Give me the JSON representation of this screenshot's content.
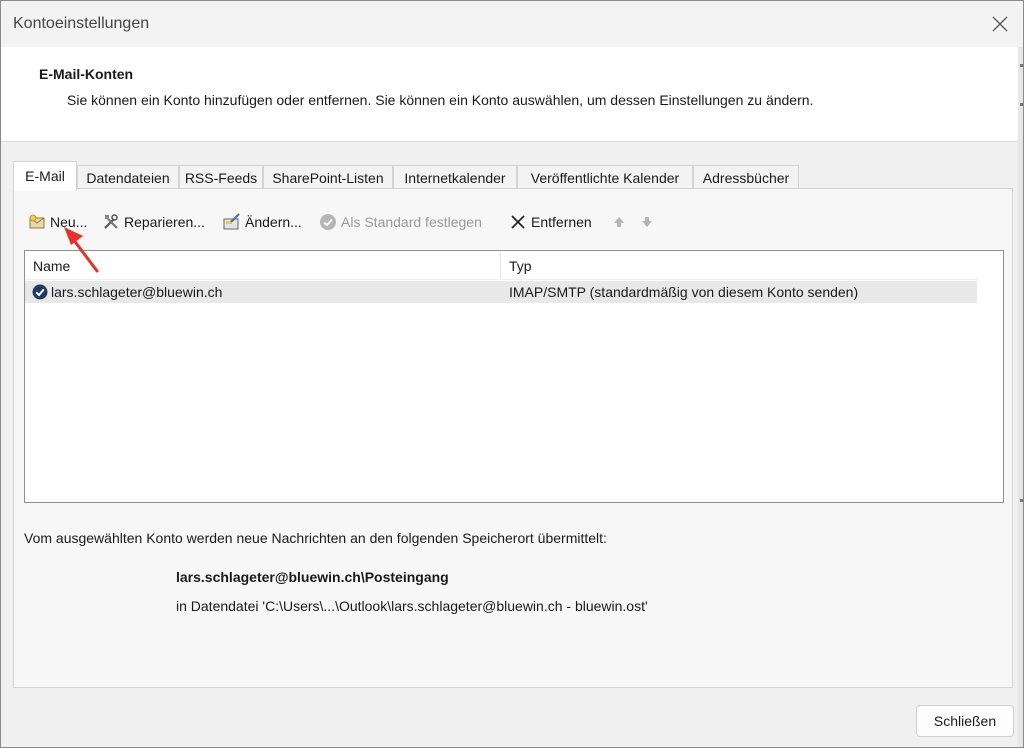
{
  "window": {
    "title": "Kontoeinstellungen"
  },
  "header": {
    "title": "E-Mail-Konten",
    "description": "Sie können ein Konto hinzufügen oder entfernen. Sie können ein Konto auswählen, um dessen Einstellungen zu ändern."
  },
  "tabs": [
    {
      "label": "E-Mail",
      "active": true
    },
    {
      "label": "Datendateien"
    },
    {
      "label": "RSS-Feeds"
    },
    {
      "label": "SharePoint-Listen"
    },
    {
      "label": "Internetkalender"
    },
    {
      "label": "Veröffentlichte Kalender"
    },
    {
      "label": "Adressbücher"
    }
  ],
  "toolbar": {
    "new_label": "Neu...",
    "repair_label": "Reparieren...",
    "change_label": "Ändern...",
    "set_default_label": "Als Standard festlegen",
    "remove_label": "Entfernen",
    "icons": [
      "new-account-icon",
      "repair-tools-icon",
      "change-icon",
      "check-circle-icon",
      "close-x-icon",
      "arrow-up-icon",
      "arrow-down-icon"
    ]
  },
  "list": {
    "columns": [
      "Name",
      "Typ"
    ],
    "rows": [
      {
        "name": "lars.schlageter@bluewin.ch",
        "type": "IMAP/SMTP (standardmäßig von diesem Konto senden)",
        "default": true
      }
    ]
  },
  "delivery": {
    "info": "Vom ausgewählten Konto werden neue Nachrichten an den folgenden Speicherort übermittelt:",
    "folder": "lars.schlageter@bluewin.ch\\Posteingang",
    "datafile": "in Datendatei 'C:\\Users\\...\\Outlook\\lars.schlageter@bluewin.ch - bluewin.ost'"
  },
  "footer": {
    "close_label": "Schließen"
  },
  "colors": {
    "annotation_arrow": "#e8302a",
    "selected_row": "#e8e8e8",
    "check_badge": "#1f3a5f"
  }
}
